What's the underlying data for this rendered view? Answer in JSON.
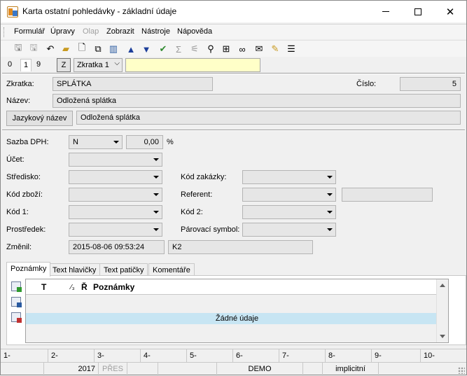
{
  "window": {
    "title": "Karta ostatní pohledávky - základní údaje",
    "minimize_icon": "minimize-icon",
    "maximize_icon": "maximize-icon",
    "close_icon": "close-icon"
  },
  "menu": [
    "Formulář",
    "Úpravy",
    "Olap",
    "Zobrazit",
    "Nástroje",
    "Nápověda"
  ],
  "toolbar": {
    "icons": [
      "save-icon",
      "save-all-icon",
      "undo-icon",
      "open-folder-icon",
      "new-document-icon",
      "copy-icon",
      "book-icon",
      "arrow-up-icon",
      "arrow-down-icon",
      "check-arrow-icon",
      "sum-icon",
      "filter-icon",
      "find-icon",
      "find-next-icon",
      "binoculars-icon",
      "mail-icon",
      "notepad-icon",
      "menu-icon"
    ]
  },
  "nav": {
    "tabs": [
      "0",
      "1",
      "9"
    ],
    "z_button": "Z",
    "abbrev_combo": "Zkratka 1",
    "search_value": ""
  },
  "header": {
    "zkratka_label": "Zkratka:",
    "zkratka_value": "SPLÁTKA",
    "cislo_label": "Číslo:",
    "cislo_value": "5",
    "nazev_label": "Název:",
    "nazev_value": "Odložená splátka",
    "lang_button": "Jazykový název",
    "lang_value": "Odložená splátka"
  },
  "detail": {
    "sazba_label": "Sazba DPH:",
    "sazba_value": "N",
    "sazba_pct": "0,00",
    "pct_sign": "%",
    "ucet_label": "Účet:",
    "stredisko_label": "Středisko:",
    "kod_zakazky_label": "Kód zakázky:",
    "kod_zbozi_label": "Kód zboží:",
    "referent_label": "Referent:",
    "kod1_label": "Kód 1:",
    "kod2_label": "Kód 2:",
    "prostredek_label": "Prostředek:",
    "parovaci_label": "Párovací symbol:",
    "zmenil_label": "Změnil:",
    "zmenil_date": "2015-08-06 09:53:24",
    "zmenil_user": "K2"
  },
  "tabs": [
    "Poznámky",
    "Text hlavičky",
    "Text patičky",
    "Komentáře"
  ],
  "grid": {
    "col_t": "T",
    "col_sub": "⁄₃",
    "col_r": "Ř",
    "col_notes": "Poznámky",
    "empty_text": "Žádné údaje"
  },
  "function_keys": [
    "1-",
    "2-",
    "3-",
    "4-",
    "5-",
    "6-",
    "7-",
    "8-",
    "9-",
    "10-"
  ],
  "status": [
    "",
    "2017",
    "PŘES",
    "",
    "",
    "DEMO",
    "",
    "implicitní",
    ""
  ]
}
